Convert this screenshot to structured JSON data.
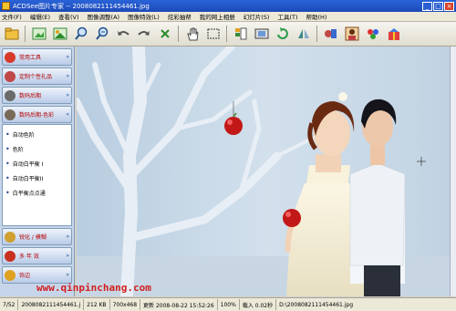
{
  "window": {
    "title": "ACDSee图片专家 -- 2008082111454461.jpg"
  },
  "menu": [
    "文件(F)",
    "编辑(E)",
    "查看(V)",
    "图像调整(A)",
    "图像特效(L)",
    "炫彩抽帮",
    "我的网上相册",
    "幻灯片(S)",
    "工具(T)",
    "帮助(H)"
  ],
  "toolbar": {
    "icons": [
      "folder-icon",
      "add-image-icon",
      "image-icon",
      "zoom-in-icon",
      "zoom-out-icon",
      "undo-icon",
      "redo-icon",
      "close-icon",
      "hand-icon",
      "select-icon",
      "layout-icon",
      "slideshow-icon",
      "rotate-icon",
      "flip-icon",
      "effects-icon",
      "portrait-icon",
      "paint-icon",
      "gift-icon"
    ]
  },
  "sidebar": {
    "sections_top": [
      {
        "label": "常用工具",
        "icon": "tools-icon",
        "color": "#d83a2a"
      },
      {
        "label": "定制个性礼品",
        "icon": "gift-icon",
        "color": "#c04848"
      },
      {
        "label": "数码后期",
        "icon": "camera-icon",
        "color": "#6a6a6a"
      },
      {
        "label": "数码后期-色彩",
        "icon": "color-camera-icon",
        "color": "#7a6a5a"
      }
    ],
    "list_items": [
      "自动色阶",
      "色阶",
      "自动白平衡 I",
      "自动白平衡II",
      "白平衡点点通"
    ],
    "sections_bottom": [
      {
        "label": "锐化 / 模糊",
        "icon": "sharpen-icon",
        "color": "#d0a030"
      },
      {
        "label": "多 年 效",
        "icon": "multi-effect-icon",
        "color": "#c83020"
      },
      {
        "label": "饰边",
        "icon": "border-icon",
        "color": "#e0a020"
      }
    ]
  },
  "watermark": "www.qinpinchang.com",
  "status": {
    "index": "7/52",
    "filename": "2008082111454461.j",
    "size": "212 KB",
    "dimensions": "700x468",
    "modified": "更新 2008-08-22 15:52:26",
    "zoom": "100%",
    "load_time": "载入 0.02秒",
    "path": "D:\\2008082111454461.jpg"
  }
}
